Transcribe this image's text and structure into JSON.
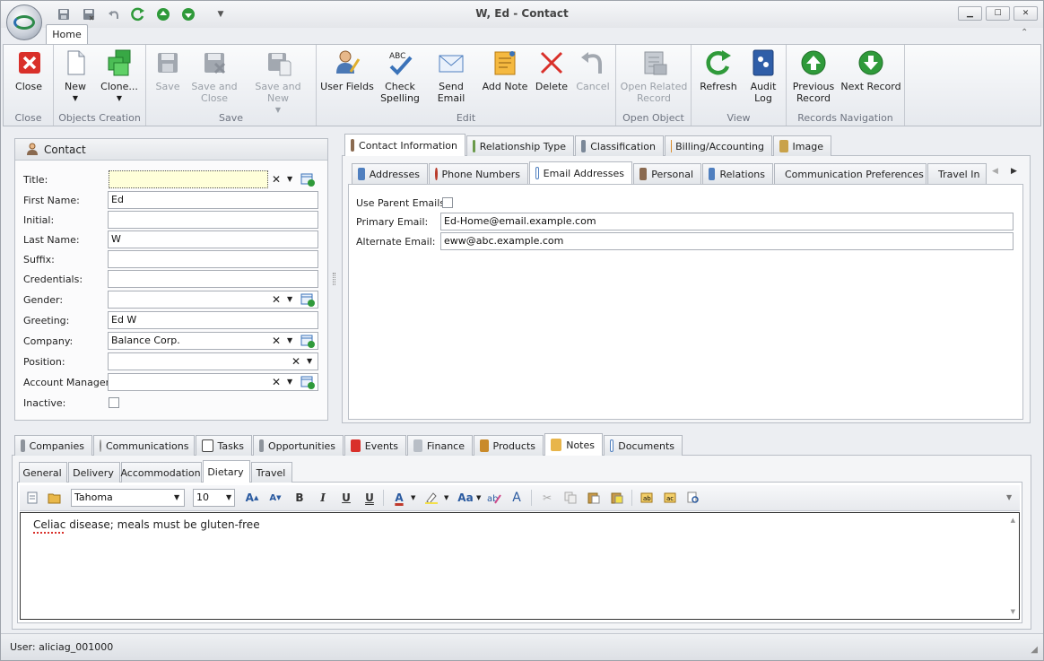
{
  "window": {
    "title": "W, Ed  - Contact"
  },
  "ribbon": {
    "tab": "Home",
    "groups": [
      {
        "label": "Close",
        "buttons": [
          "Close"
        ]
      },
      {
        "label": "Objects Creation",
        "buttons": [
          "New",
          "Clone..."
        ]
      },
      {
        "label": "Save",
        "buttons": [
          "Save",
          "Save and Close",
          "Save and New"
        ]
      },
      {
        "label": "Edit",
        "buttons": [
          "User Fields",
          "Check Spelling",
          "Send Email",
          "Add Note",
          "Delete",
          "Cancel"
        ]
      },
      {
        "label": "Open Object",
        "buttons": [
          "Open Related Record"
        ]
      },
      {
        "label": "View",
        "buttons": [
          "Refresh",
          "Audit Log"
        ]
      },
      {
        "label": "Records Navigation",
        "buttons": [
          "Previous Record",
          "Next Record"
        ]
      }
    ],
    "close": {
      "label": "Close"
    },
    "new": {
      "label": "New"
    },
    "clone": {
      "label": "Clone..."
    },
    "save": {
      "label": "Save"
    },
    "save_close": {
      "label": "Save and Close"
    },
    "save_new": {
      "label": "Save and New"
    },
    "user_fields": {
      "label": "User Fields"
    },
    "check_spelling": {
      "label": "Check Spelling"
    },
    "send_email": {
      "label": "Send Email"
    },
    "add_note": {
      "label": "Add Note"
    },
    "delete": {
      "label": "Delete"
    },
    "cancel": {
      "label": "Cancel"
    },
    "open_related": {
      "label": "Open Related Record"
    },
    "refresh": {
      "label": "Refresh"
    },
    "audit_log": {
      "label": "Audit Log"
    },
    "previous": {
      "label": "Previous Record"
    },
    "next": {
      "label": "Next Record"
    }
  },
  "contact": {
    "header": "Contact",
    "fields": {
      "title": {
        "label": "Title:",
        "value": ""
      },
      "first_name": {
        "label": "First Name:",
        "value": "Ed"
      },
      "initial": {
        "label": "Initial:",
        "value": ""
      },
      "last_name": {
        "label": "Last Name:",
        "value": "W"
      },
      "suffix": {
        "label": "Suffix:",
        "value": ""
      },
      "credentials": {
        "label": "Credentials:",
        "value": ""
      },
      "gender": {
        "label": "Gender:",
        "value": ""
      },
      "greeting": {
        "label": "Greeting:",
        "value": "Ed W"
      },
      "company": {
        "label": "Company:",
        "value": "Balance Corp."
      },
      "position": {
        "label": "Position:",
        "value": ""
      },
      "account_manager": {
        "label": "Account Manager:",
        "value": ""
      },
      "inactive": {
        "label": "Inactive:",
        "checked": false
      }
    }
  },
  "info_tabs": [
    "Contact Information",
    "Relationship Type",
    "Classification",
    "Billing/Accounting",
    "Image"
  ],
  "info_active": "Contact Information",
  "sub_tabs": [
    "Addresses",
    "Phone Numbers",
    "Email Addresses",
    "Personal",
    "Relations",
    "Communication Preferences",
    "Travel In"
  ],
  "sub_active": "Email Addresses",
  "email": {
    "use_parent": {
      "label": "Use Parent Emails:",
      "checked": false
    },
    "primary": {
      "label": "Primary Email:",
      "value": "Ed-Home@email.example.com"
    },
    "alternate": {
      "label": "Alternate Email:",
      "value": "eww@abc.example.com"
    }
  },
  "bottom_tabs": [
    "Companies",
    "Communications",
    "Tasks",
    "Opportunities",
    "Events",
    "Finance",
    "Products",
    "Notes",
    "Documents"
  ],
  "bottom_active": "Notes",
  "note_tabs": [
    "General",
    "Delivery",
    "Accommodation",
    "Dietary",
    "Travel"
  ],
  "note_active": "Dietary",
  "editor": {
    "font": "Tahoma",
    "size": "10",
    "text": "Celiac disease; meals must be gluten-free"
  },
  "status": {
    "user": "User: aliciag_001000"
  },
  "colors": {
    "accent_green": "#2f9a3a",
    "red": "#d9302a",
    "blue": "#3b73b9"
  }
}
